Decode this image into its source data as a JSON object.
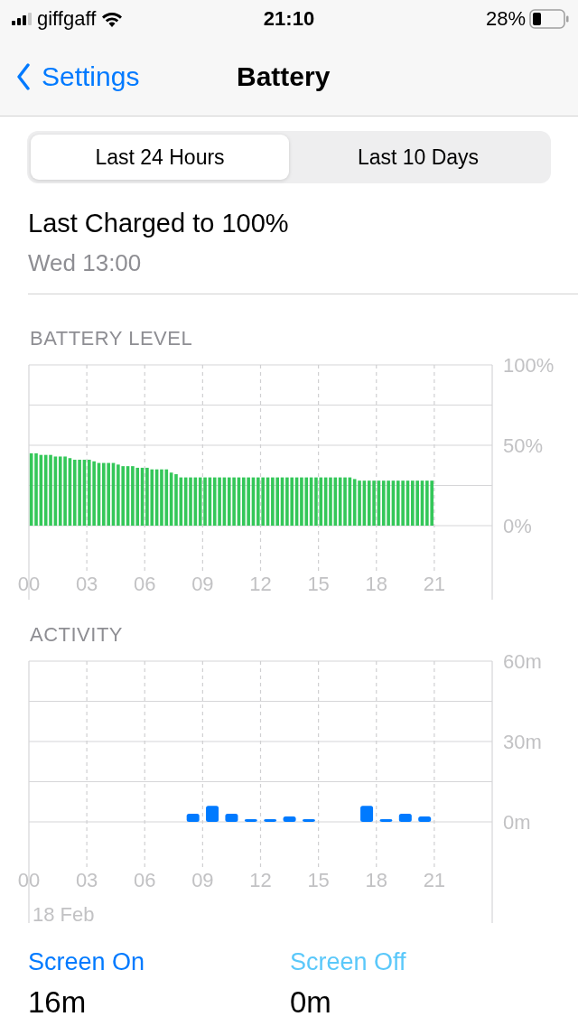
{
  "status_bar": {
    "carrier": "giffgaff",
    "time": "21:10",
    "battery_percent": "28%"
  },
  "nav": {
    "back_label": "Settings",
    "title": "Battery"
  },
  "segments": [
    {
      "label": "Last 24 Hours",
      "selected": true
    },
    {
      "label": "Last 10 Days",
      "selected": false
    }
  ],
  "last_charged": {
    "title": "Last Charged to 100%",
    "time": "Wed 13:00"
  },
  "battery_chart": {
    "title": "BATTERY LEVEL",
    "chart_data": {
      "type": "bar",
      "x": [
        0.125,
        0.375,
        0.625,
        0.875,
        1.125,
        1.375,
        1.625,
        1.875,
        2.125,
        2.375,
        2.625,
        2.875,
        3.125,
        3.375,
        3.625,
        3.875,
        4.125,
        4.375,
        4.625,
        4.875,
        5.125,
        5.375,
        5.625,
        5.875,
        6.125,
        6.375,
        6.625,
        6.875,
        7.125,
        7.375,
        7.625,
        7.875,
        8.125,
        8.375,
        8.625,
        8.875,
        9.125,
        9.375,
        9.625,
        9.875,
        10.125,
        10.375,
        10.625,
        10.875,
        11.125,
        11.375,
        11.625,
        11.875,
        12.125,
        12.375,
        12.625,
        12.875,
        13.125,
        13.375,
        13.625,
        13.875,
        14.125,
        14.375,
        14.625,
        14.875,
        15.125,
        15.375,
        15.625,
        15.875,
        16.125,
        16.375,
        16.625,
        16.875,
        17.125,
        17.375,
        17.625,
        17.875,
        18.125,
        18.375,
        18.625,
        18.875,
        19.125,
        19.375,
        19.625,
        19.875,
        20.125,
        20.375,
        20.625,
        20.875
      ],
      "series": [
        {
          "color": "#34c759",
          "values": [
            45,
            45,
            44,
            44,
            44,
            43,
            43,
            43,
            42,
            41,
            41,
            41,
            41,
            40,
            39,
            39,
            39,
            39,
            38,
            37,
            37,
            37,
            36,
            36,
            36,
            35,
            35,
            35,
            35,
            33,
            32,
            30,
            30,
            30,
            30,
            30,
            30,
            30,
            30,
            30,
            30,
            30,
            30,
            30,
            30,
            30,
            30,
            30,
            30,
            30,
            30,
            30,
            30,
            30,
            30,
            30,
            30,
            30,
            30,
            30,
            30,
            30,
            30,
            30,
            30,
            30,
            30,
            29,
            28,
            28,
            28,
            28,
            28,
            28,
            28,
            28,
            28,
            28,
            28,
            28,
            28,
            28,
            28,
            28
          ]
        }
      ],
      "grid": true,
      "xlim": [
        0,
        24
      ],
      "ylim": [
        0,
        100
      ],
      "xticks": [
        {
          "value": 0,
          "label": "00"
        },
        {
          "value": 3,
          "label": "03"
        },
        {
          "value": 6,
          "label": "06"
        },
        {
          "value": 9,
          "label": "09"
        },
        {
          "value": 12,
          "label": "12"
        },
        {
          "value": 15,
          "label": "15"
        },
        {
          "value": 18,
          "label": "18"
        },
        {
          "value": 21,
          "label": "21"
        }
      ],
      "yticks": [
        {
          "value": 0,
          "label": "0%"
        },
        {
          "value": 50,
          "label": "50%"
        },
        {
          "value": 100,
          "label": "100%"
        }
      ]
    }
  },
  "activity_chart": {
    "title": "ACTIVITY",
    "date_label": "18 Feb",
    "chart_data": {
      "type": "bar",
      "x": [
        0.5,
        1.5,
        2.5,
        3.5,
        4.5,
        5.5,
        6.5,
        7.5,
        8.5,
        9.5,
        10.5,
        11.5,
        12.5,
        13.5,
        14.5,
        15.5,
        16.5,
        17.5,
        18.5,
        19.5,
        20.5
      ],
      "series": [
        {
          "color": "#007aff",
          "values": [
            0,
            0,
            0,
            0,
            0,
            0,
            0,
            0,
            3,
            6,
            3,
            1,
            1,
            2,
            1,
            0,
            0,
            6,
            1,
            3,
            2
          ]
        }
      ],
      "grid": true,
      "xlim": [
        0,
        24
      ],
      "ylim": [
        0,
        60
      ],
      "xticks": [
        {
          "value": 0,
          "label": "00"
        },
        {
          "value": 3,
          "label": "03"
        },
        {
          "value": 6,
          "label": "06"
        },
        {
          "value": 9,
          "label": "09"
        },
        {
          "value": 12,
          "label": "12"
        },
        {
          "value": 15,
          "label": "15"
        },
        {
          "value": 18,
          "label": "18"
        },
        {
          "value": 21,
          "label": "21"
        }
      ],
      "yticks": [
        {
          "value": 0,
          "label": "0m"
        },
        {
          "value": 30,
          "label": "30m"
        },
        {
          "value": 60,
          "label": "60m"
        }
      ]
    }
  },
  "screen_time": [
    {
      "label": "Screen On",
      "value": "16m",
      "color": "#007aff"
    },
    {
      "label": "Screen Off",
      "value": "0m",
      "color": "#5ac8fa"
    }
  ]
}
